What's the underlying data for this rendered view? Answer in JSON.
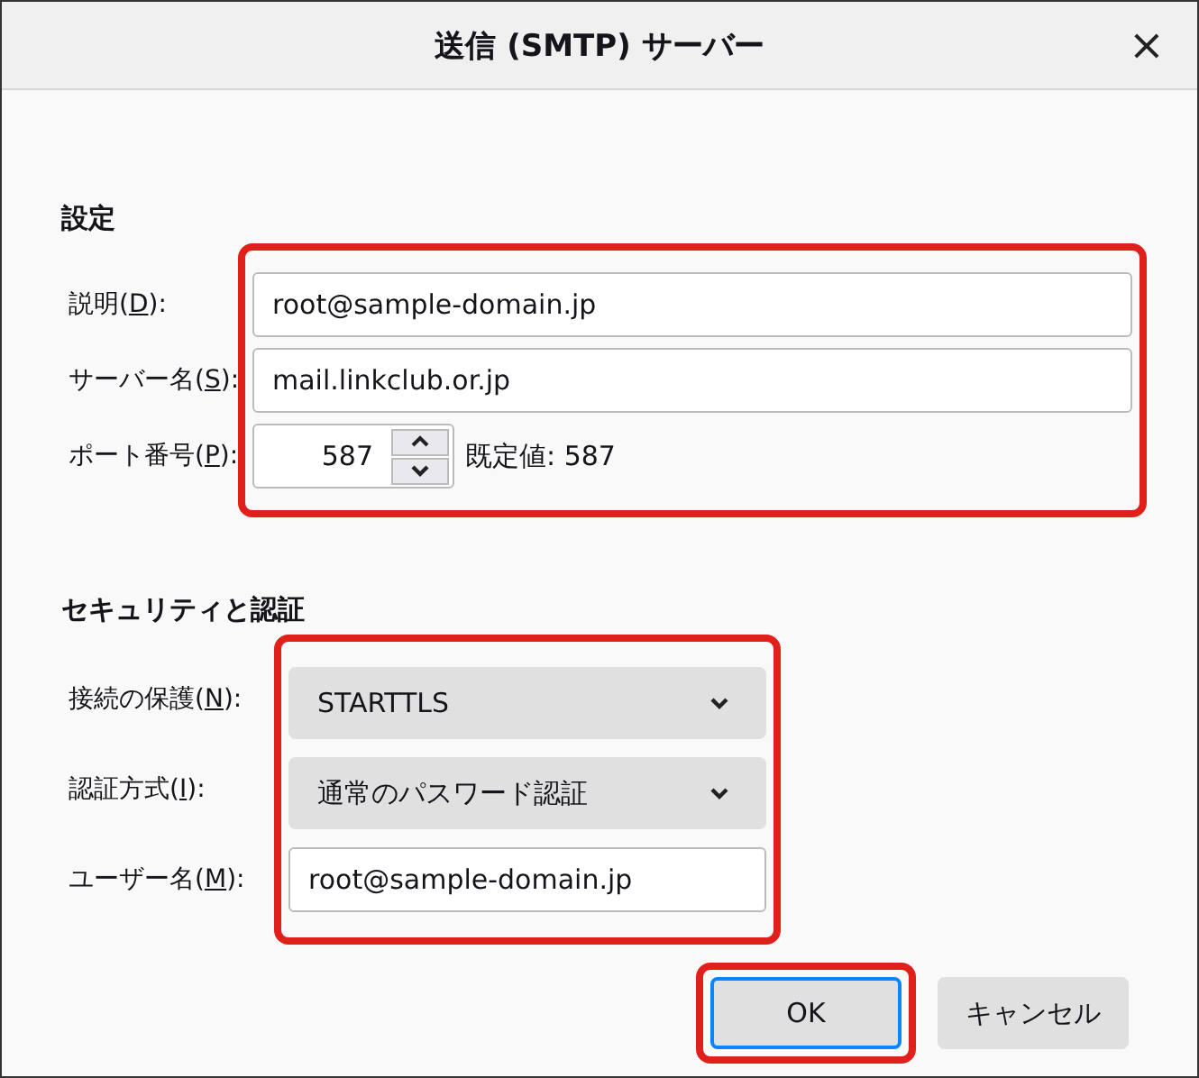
{
  "window": {
    "title": "送信 (SMTP) サーバー",
    "close": "×"
  },
  "sections": [
    {
      "heading": "設定",
      "highlighted": true,
      "rows": [
        {
          "kind": "text",
          "label_before": "説明(",
          "accesskey": "D",
          "label_after": "):",
          "value": "root@sample-domain.jp"
        },
        {
          "kind": "text",
          "label_before": "サーバー名(",
          "accesskey": "S",
          "label_after": "):",
          "value": "mail.linkclub.or.jp"
        },
        {
          "kind": "spin",
          "label_before": "ポート番号(",
          "accesskey": "P",
          "label_after": "):",
          "value": "587",
          "note": "既定値:  587"
        }
      ]
    },
    {
      "heading": "セキュリティと認証",
      "highlighted": true,
      "rows": [
        {
          "kind": "select",
          "label_before": "接続の保護(",
          "accesskey": "N",
          "label_after": "):",
          "value": "STARTTLS"
        },
        {
          "kind": "select",
          "label_before": "認証方式(",
          "accesskey": "I",
          "label_after": "):",
          "value": "通常のパスワード認証"
        },
        {
          "kind": "text",
          "label_before": "ユーザー名(",
          "accesskey": "M",
          "label_after": "):",
          "value": "root@sample-domain.jp"
        }
      ]
    }
  ],
  "buttons": [
    {
      "label": "OK",
      "default": true,
      "highlighted": true
    },
    {
      "label": "キャンセル",
      "default": false,
      "highlighted": false
    }
  ]
}
